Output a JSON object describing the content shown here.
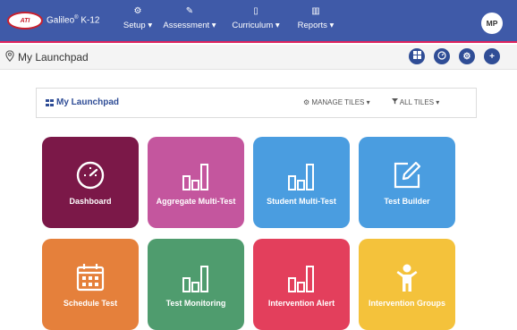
{
  "app": {
    "logo_badge": "ATI",
    "logo_name": "Galileo",
    "logo_mark": "®",
    "logo_suffix": "K-12"
  },
  "nav": [
    {
      "label": "Setup ▾",
      "icon": "gear-icon"
    },
    {
      "label": "Assessment ▾",
      "icon": "edit-icon"
    },
    {
      "label": "Curriculum ▾",
      "icon": "book-icon"
    },
    {
      "label": "Reports ▾",
      "icon": "bar-chart-icon"
    }
  ],
  "user": {
    "initials": "MP"
  },
  "subbar": {
    "title": "My Launchpad"
  },
  "panel": {
    "title": "My Launchpad",
    "manage_tiles": "MANAGE TILES ▾",
    "all_tiles": "ALL TILES ▾"
  },
  "tiles": [
    {
      "label": "Dashboard",
      "icon": "speedometer-icon",
      "color": "#7b1848"
    },
    {
      "label": "Aggregate Multi-Test",
      "icon": "bar-chart-icon",
      "color": "#c4569e"
    },
    {
      "label": "Student Multi-Test",
      "icon": "bar-chart-icon",
      "color": "#4a9de0"
    },
    {
      "label": "Test Builder",
      "icon": "edit-icon",
      "color": "#4a9de0"
    },
    {
      "label": "Schedule Test",
      "icon": "calendar-icon",
      "color": "#e5803b"
    },
    {
      "label": "Test Monitoring",
      "icon": "bar-chart-icon",
      "color": "#4f9c6e"
    },
    {
      "label": "Intervention Alert",
      "icon": "bar-chart-icon",
      "color": "#e33f5c"
    },
    {
      "label": "Intervention Groups",
      "icon": "person-icon",
      "color": "#f4c23b"
    }
  ]
}
